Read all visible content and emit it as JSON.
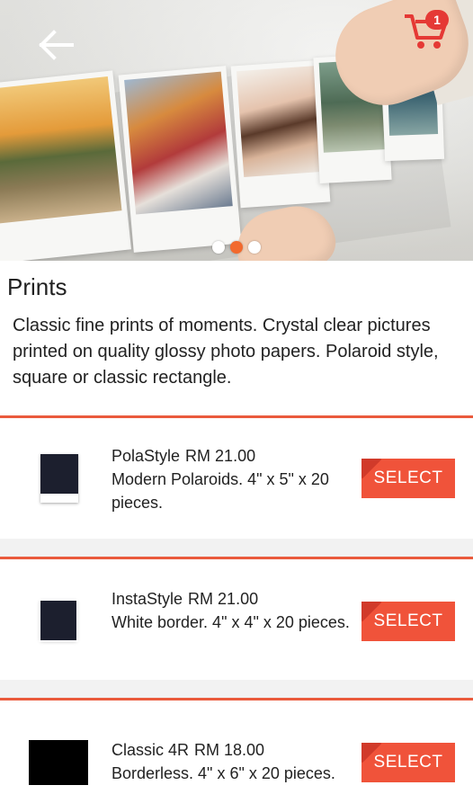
{
  "header": {
    "back_icon": "arrow-left-icon",
    "cart_icon": "shopping-cart-icon",
    "cart_count": "1"
  },
  "carousel": {
    "slide_count": 3,
    "active_index": 1
  },
  "page": {
    "title": "Prints",
    "description": "Classic fine prints of moments. Crystal clear pictures printed on quality glossy photo papers. Polaroid style, square or classic rectangle."
  },
  "products": [
    {
      "name": "PolaStyle",
      "price": "RM 21.00",
      "details": "Modern Polaroids. 4\" x 5\" x 20 pieces.",
      "button": "SELECT"
    },
    {
      "name": "InstaStyle",
      "price": "RM 21.00",
      "details": "White border. 4\" x 4\" x 20 pieces.",
      "button": "SELECT"
    },
    {
      "name": "Classic 4R",
      "price": "RM 18.00",
      "details": "Borderless. 4\" x 6\" x 20 pieces.",
      "button": "SELECT"
    }
  ],
  "colors": {
    "accent": "#f0533a",
    "divider": "#ea5a3c",
    "badge": "#e53935",
    "dot_active": "#f26a2e"
  }
}
